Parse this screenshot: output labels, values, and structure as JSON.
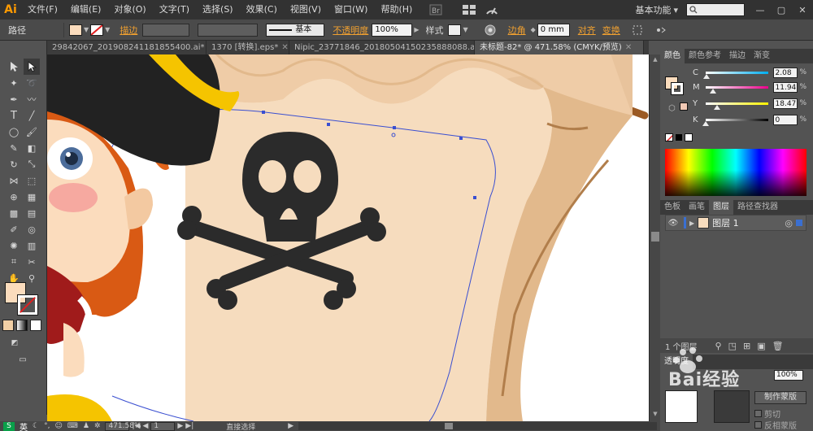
{
  "app": {
    "logo": "Ai"
  },
  "menu": [
    "文件(F)",
    "编辑(E)",
    "对象(O)",
    "文字(T)",
    "选择(S)",
    "效果(C)",
    "视图(V)",
    "窗口(W)",
    "帮助(H)"
  ],
  "menu_right": {
    "workspace": "基本功能",
    "workspace_arrow": "▾"
  },
  "control": {
    "object_type": "路径",
    "stroke_label": "描边",
    "stroke_style": "基本",
    "opacity_label": "不透明度",
    "opacity_value": "100%",
    "style_label": "样式",
    "corner_label": "边角",
    "corner_value": "0 mm",
    "align_label": "对齐",
    "transform_label": "变换",
    "fill_color": "#fbdcbd"
  },
  "tabs": [
    {
      "label": "29842067_201908241181855400.ai*",
      "active": false
    },
    {
      "label": "1370 [转换].eps*",
      "active": false
    },
    {
      "label": "Nipic_23771846_20180504150235888088.ai*",
      "active": false
    },
    {
      "label": "未标题-82* @ 471.58% (CMYK/预览)",
      "active": true
    }
  ],
  "color_panel": {
    "tabs": [
      "颜色",
      "颜色参考",
      "描边",
      "渐变"
    ],
    "channels": [
      {
        "ch": "C",
        "value": "2.08",
        "gradient": "linear-gradient(to right,#fff,#00aeef)",
        "fraction": 0.0208
      },
      {
        "ch": "M",
        "value": "11.94",
        "gradient": "linear-gradient(to right,#fff,#ec008c)",
        "fraction": 0.1194
      },
      {
        "ch": "Y",
        "value": "18.47",
        "gradient": "linear-gradient(to right,#fff,#fff200)",
        "fraction": 0.1847
      },
      {
        "ch": "K",
        "value": "0",
        "gradient": "linear-gradient(to right,#fff,#000)",
        "fraction": 0.0
      }
    ],
    "unit": "%"
  },
  "layers_panel": {
    "tabs": [
      "色板",
      "画笔",
      "图层",
      "路径查找器"
    ],
    "layer_name": "图层 1",
    "count": "1 个图层"
  },
  "lower_panel": {
    "tab": "透明度",
    "opacity_value": "100%",
    "mask_button": "制作蒙版",
    "clip_label": "剪切",
    "invert_label": "反相蒙版"
  },
  "status": {
    "zoom": "471.58%",
    "page": "1",
    "tool": "直接选择"
  },
  "ime": {
    "lang": "英"
  },
  "watermark": "Bai经验",
  "colors": {
    "skin": "#fbdcbd",
    "parchment": "#f6dcbe",
    "parchment_dark": "#e8c39c",
    "skull": "#2b2b2b",
    "hat": "#222222",
    "hat_band": "#f5c400",
    "hair": "#e2641a",
    "mast": "#9b5a24",
    "path": "#3a4fd1"
  }
}
